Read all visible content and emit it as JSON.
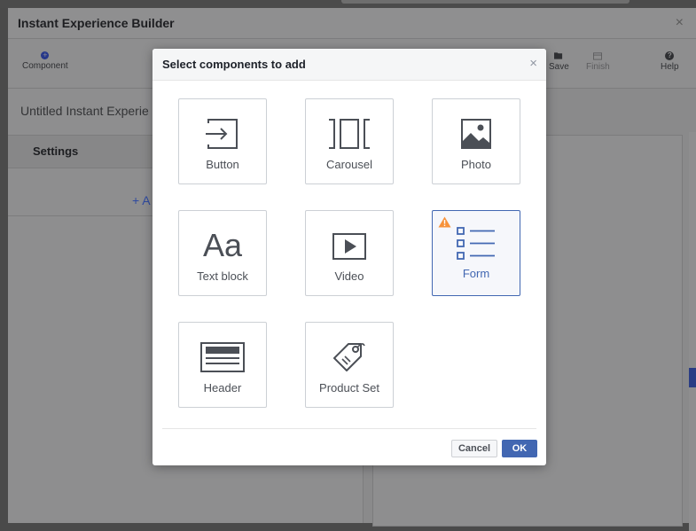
{
  "window": {
    "title": "Instant Experience Builder",
    "close_glyph": "×"
  },
  "toolbar": {
    "component_label": "Component",
    "save_label": "Save",
    "finish_label": "Finish",
    "help_label": "Help"
  },
  "left_panel": {
    "doc_title": "Untitled Instant Experie",
    "settings_label": "Settings",
    "add_label": "+ A"
  },
  "modal": {
    "title": "Select components to add",
    "close_glyph": "×",
    "tiles": [
      {
        "label": "Button",
        "icon": "button-icon"
      },
      {
        "label": "Carousel",
        "icon": "carousel-icon"
      },
      {
        "label": "Photo",
        "icon": "photo-icon"
      },
      {
        "label": "Text block",
        "icon": "text-block-icon",
        "glyph": "Aa"
      },
      {
        "label": "Video",
        "icon": "video-icon"
      },
      {
        "label": "Form",
        "icon": "form-icon",
        "selected": true,
        "warning": true
      },
      {
        "label": "Header",
        "icon": "header-icon"
      },
      {
        "label": "Product Set",
        "icon": "product-set-icon"
      }
    ],
    "cancel_label": "Cancel",
    "ok_label": "OK"
  },
  "colors": {
    "accent": "#4267b2",
    "warning": "#f7923b",
    "icon": "#4b4f56"
  }
}
